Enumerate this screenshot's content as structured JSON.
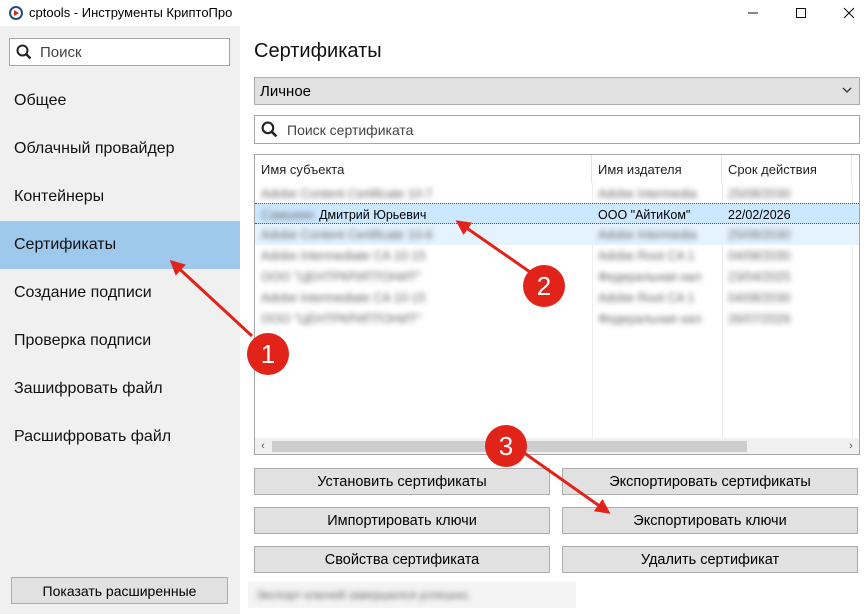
{
  "window": {
    "title": "cptools - Инструменты КриптоПро",
    "minimize": "—",
    "maximize": "☐",
    "close": "✕"
  },
  "sidebar": {
    "search_placeholder": "Поиск",
    "items": [
      {
        "label": "Общее"
      },
      {
        "label": "Облачный провайдер"
      },
      {
        "label": "Контейнеры"
      },
      {
        "label": "Сертификаты",
        "active": true
      },
      {
        "label": "Создание подписи"
      },
      {
        "label": "Проверка подписи"
      },
      {
        "label": "Зашифровать файл"
      },
      {
        "label": "Расшифровать файл"
      }
    ],
    "advanced_button": "Показать расширенные"
  },
  "main": {
    "title": "Сертификаты",
    "store_select": "Личное",
    "cert_search_placeholder": "Поиск сертификата",
    "table": {
      "columns": [
        "Имя субъекта",
        "Имя издателя",
        "Срок действия"
      ],
      "rows": [
        {
          "subject_hidden": "Adobe Content Certificate 10-7",
          "subject": "",
          "issuer": "Adobe Intermedia",
          "expires": "25/08/2030",
          "blurred": true
        },
        {
          "subject_hidden": "Самыкин",
          "subject": "Дмитрий Юрьевич",
          "issuer": "ООО \"АйтиКом\"",
          "expires": "22/02/2026",
          "selected": true
        },
        {
          "subject_hidden": "Adobe Content Certificate 10-6",
          "subject": "",
          "issuer": "Adobe Intermedia",
          "expires": "25/08/2030",
          "blurred": true
        },
        {
          "subject_hidden": "Adobe Intermediate CA 10-15",
          "subject": "",
          "issuer": "Adobe Root CA 1",
          "expires": "04/08/2030",
          "blurred": true
        },
        {
          "subject_hidden": "ООО \"ЦЕНТРКРИПТОНИТ\"",
          "subject": "",
          "issuer": "Федеральная нал",
          "expires": "23/04/2025",
          "blurred": true
        },
        {
          "subject_hidden": "Adobe Intermediate CA 10-15",
          "subject": "",
          "issuer": "Adobe Root CA 1",
          "expires": "04/08/2030",
          "blurred": true
        },
        {
          "subject_hidden": "ООО \"ЦЕНТРКРИПТОНИТ\"",
          "subject": "",
          "issuer": "Федеральная нал",
          "expires": "26/07/2026",
          "blurred": true
        }
      ]
    },
    "buttons": {
      "install": "Установить сертификаты",
      "export_certs": "Экспортировать сертификаты",
      "import_keys": "Импортировать ключи",
      "export_keys": "Экспортировать ключи",
      "properties": "Свойства сертификата",
      "delete": "Удалить сертификат"
    },
    "status": "Экспорт ключей завершился успешно."
  },
  "annotations": {
    "badges": [
      "1",
      "2",
      "3"
    ],
    "color": "#e2231a"
  }
}
